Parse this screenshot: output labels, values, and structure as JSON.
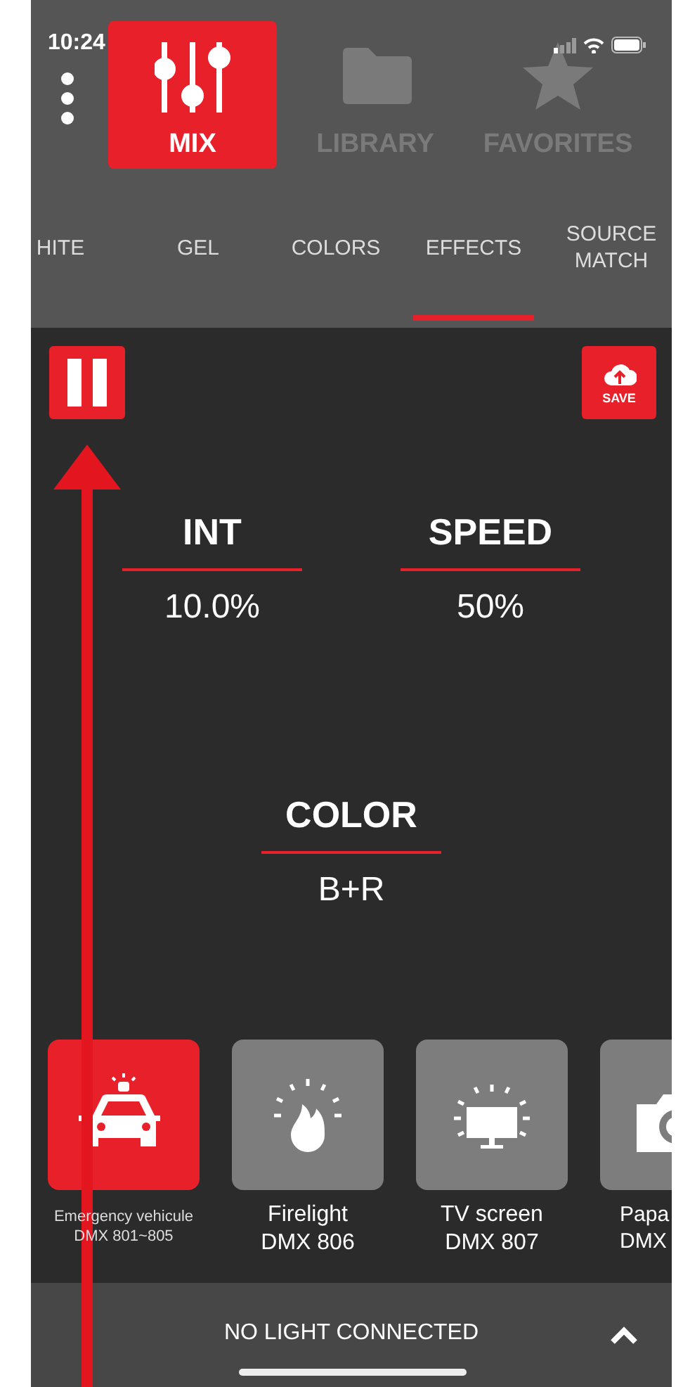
{
  "status_bar": {
    "time": "10:24"
  },
  "nav": [
    {
      "label": "MIX",
      "selected": true
    },
    {
      "label": "LIBRARY",
      "selected": false
    },
    {
      "label": "FAVORITES",
      "selected": false
    }
  ],
  "tabs": [
    {
      "label": "HITE",
      "selected": false
    },
    {
      "label": "GEL",
      "selected": false
    },
    {
      "label": "COLORS",
      "selected": false
    },
    {
      "label": "EFFECTS",
      "selected": true
    },
    {
      "label": "SOURCE MATCH",
      "selected": false
    }
  ],
  "toolbar": {
    "playing": true,
    "save_label": "SAVE"
  },
  "params": [
    {
      "label": "INT",
      "value": "10.0%"
    },
    {
      "label": "SPEED",
      "value": "50%"
    },
    {
      "label": "COLOR",
      "value": "B+R"
    }
  ],
  "presets": [
    {
      "name": "Emergency vehicule",
      "dmx": "DMX 801~805",
      "selected": true
    },
    {
      "name": "Firelight",
      "dmx": "DMX 806",
      "selected": false
    },
    {
      "name": "TV screen",
      "dmx": "DMX 807",
      "selected": false
    },
    {
      "name": "Papa",
      "dmx": "DMX",
      "selected": false
    }
  ],
  "footer": {
    "status": "NO LIGHT CONNECTED"
  }
}
